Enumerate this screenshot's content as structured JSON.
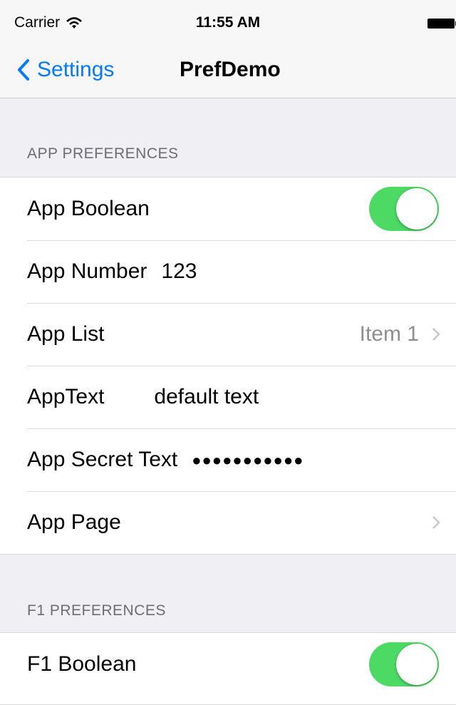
{
  "status_bar": {
    "carrier": "Carrier",
    "time": "11:55 AM"
  },
  "nav": {
    "back_label": "Settings",
    "title": "PrefDemo"
  },
  "sections": {
    "app": {
      "header": "APP PREFERENCES",
      "boolean": {
        "label": "App Boolean",
        "enabled": true
      },
      "number": {
        "label": "App Number",
        "value": "123"
      },
      "list": {
        "label": "App List",
        "value": "Item 1"
      },
      "text": {
        "label": "AppText",
        "value": "default text"
      },
      "secret": {
        "label": "App Secret Text",
        "value": "●●●●●●●●●●●"
      },
      "page": {
        "label": "App Page"
      }
    },
    "f1": {
      "header": "F1 PREFERENCES",
      "boolean": {
        "label": "F1 Boolean",
        "enabled": true
      }
    }
  },
  "colors": {
    "accent": "#007aff",
    "toggle_on": "#4cd964",
    "background": "#efeff4"
  },
  "icons": [
    "wifi-icon",
    "battery-icon",
    "back-chevron-icon",
    "disclosure-chevron-icon"
  ]
}
